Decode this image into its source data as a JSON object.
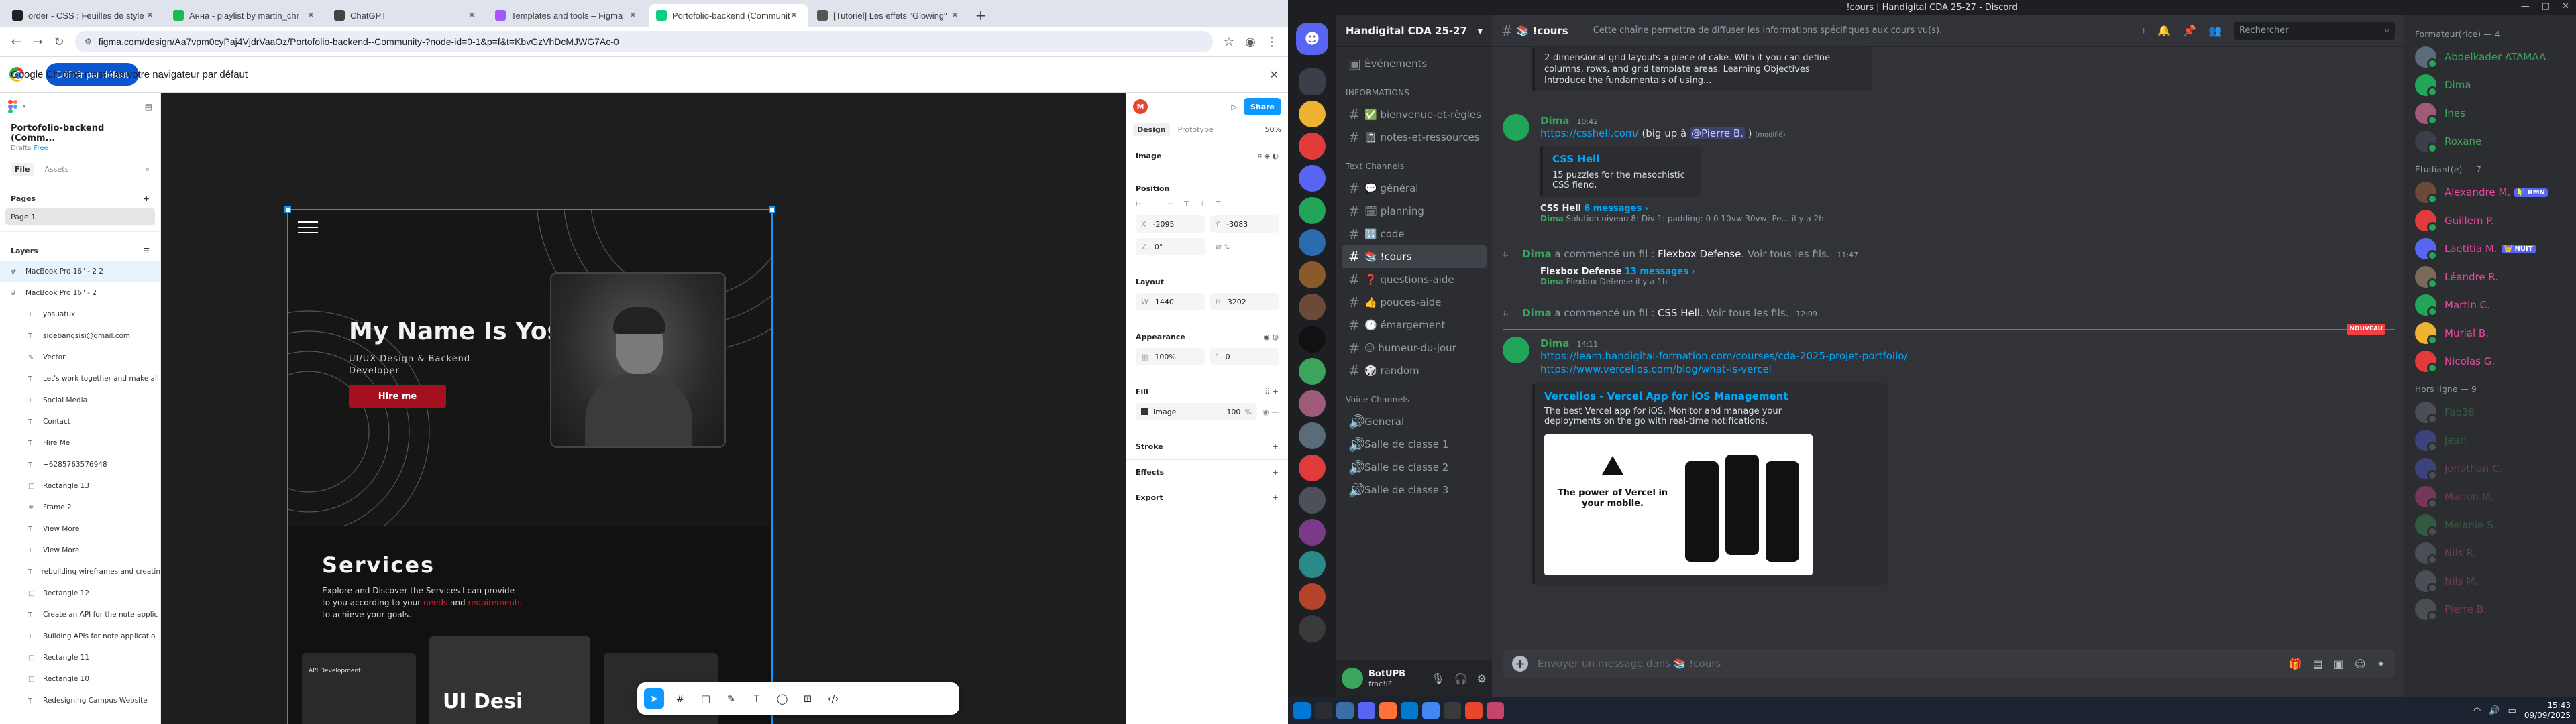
{
  "chrome": {
    "tabs": [
      {
        "title": "order - CSS : Feuilles de style",
        "color": "#202124"
      },
      {
        "title": "Анна - playlist by martin_chr",
        "color": "#1db954"
      },
      {
        "title": "ChatGPT",
        "color": "#444444"
      },
      {
        "title": "Templates and tools – Figma",
        "color": "#a259ff"
      },
      {
        "title": "Portofolio-backend (Community)",
        "color": "#0acf83"
      },
      {
        "title": "[Tutoriel] Les effets \"Glowing\"",
        "color": "#555555"
      }
    ],
    "url": "figma.com/design/Aa7vpm0cyPaj4VjdrVaaOz/Portofolio-backend--Community-?node-id=0-1&p=f&t=KbvGzVhDcMJWG7Ac-0",
    "infobar_message": "Google Chrome n'est pas votre navigateur par défaut",
    "infobar_button": "Définir par défaut"
  },
  "figma": {
    "project": "Portofolio-backend (Comm...",
    "status_left": "Drafts",
    "status_right": "Free",
    "tabs": {
      "file": "File",
      "assets": "Assets"
    },
    "pages_label": "Pages",
    "pages": [
      "Page 1"
    ],
    "layers_label": "Layers",
    "layers_top": [
      {
        "label": "MacBook Pro 16\" - 2 2",
        "selected": true
      },
      {
        "label": "MacBook Pro 16\" - 2",
        "selected": false
      }
    ],
    "layers": [
      "yosuatux",
      "sidebangsisi@gmail.com",
      "Vector",
      "Let's work together and make all",
      "Social Media",
      "Contact",
      "Hire Me",
      "+6285763576948",
      "Rectangle 13",
      "Frame 2",
      "View More",
      "View More",
      "rebuilding wireframes and creatin",
      "Rectangle 12",
      "Create an API for the note applic",
      "Building APIs for note applicatio",
      "Rectangle 11",
      "Rectangle 10",
      "Redesigning Campus Website"
    ],
    "canvas": {
      "name": "My Name Is Yosua",
      "role": "UI/UX Design & Backend Developer",
      "hire": "Hire me",
      "services_title": "Services",
      "services_text_a": "Explore and Discover the Services I can provide to you according to your",
      "services_needs": "needs",
      "services_and": "and",
      "services_req": "requirements",
      "services_text_b": "to achieve your goals.",
      "ui_title": "UI Desi",
      "api_label": "API Development"
    },
    "right": {
      "avatar": "M",
      "share": "Share",
      "tabs": {
        "design": "Design",
        "prototype": "Prototype"
      },
      "zoom": "50%",
      "image_label": "Image",
      "position_label": "Position",
      "x": "-2095",
      "y": "-3083",
      "rotation": "0°",
      "layout_label": "Layout",
      "w": "1440",
      "h": "3202",
      "appearance_label": "Appearance",
      "opacity": "100%",
      "radius": "0",
      "fill_label": "Fill",
      "fill_name": "Image",
      "fill_opacity": "100",
      "fill_pct": "%",
      "stroke_label": "Stroke",
      "effects_label": "Effects",
      "export_label": "Export"
    },
    "help": "?"
  },
  "discord": {
    "window_title": "!cours | Handigital CDA 25-27 - Discord",
    "server_name": "Handigital CDA 25-27",
    "events": "Événements",
    "info_cat": "INFORMATIONS",
    "channels_info": [
      "✅ bienvenue-et-règles",
      "📓 notes-et-ressources"
    ],
    "text_cat": "Text Channels",
    "channels_text": [
      "💬 général",
      "🗓 planning",
      "🔢 code",
      "📚 !cours",
      "❓ questions-aide",
      "👍 pouces-aide",
      "🕐 émargement",
      "😐 humeur-du-jour",
      "🎲 random"
    ],
    "selected_channel": "📚 !cours",
    "voice_cat": "Voice Channels",
    "voice": [
      "General",
      "Salle de classe 1",
      "Salle de classe 2",
      "Salle de classe 3"
    ],
    "user_name": "BotUPB",
    "user_status": "frac!IF",
    "header_channel": "📚 !cours",
    "topic": "Cette chaîne permettra de diffuser les informations spécifiques aux cours vu(s).",
    "search": "Rechercher",
    "quote_lines": [
      "2-dimensional grid layouts a piece of cake. With it you can define",
      "columns, rows, and grid template areas. Learning Objectives",
      "Introduce the fundamentals of using..."
    ],
    "msg1": {
      "author": "Dima",
      "time": "10:42",
      "link": "https://csshell.com/",
      "text": "(big up à",
      "mention": "@Pierre B.",
      "close": ")",
      "edited": "(modifié)",
      "embed_title": "CSS Hell",
      "embed_desc": "15 puzzles for the masochistic CSS fiend.",
      "thread_name": "CSS Hell",
      "thread_count": "6 messages ›",
      "thread_author": "Dima",
      "thread_preview": "Solution niveau 8: Div 1: padding: 0 0 10vw 30vw; Pe...",
      "thread_ago": "il y a 2h"
    },
    "sys1": {
      "user": "Dima",
      "text": "a commencé un fil :",
      "thread": "Flexbox Defense",
      "see": "Voir tous les fils.",
      "time": "11:47"
    },
    "thread2": {
      "name": "Flexbox Defense",
      "count": "13 messages ›",
      "author": "Dima",
      "preview": "Flexbox Defense",
      "ago": "il y a 1h"
    },
    "sys2": {
      "user": "Dima",
      "text": "a commencé un fil :",
      "thread": "CSS Hell",
      "see": "Voir tous les fils.",
      "time": "12:09"
    },
    "new_badge": "NOUVEAU",
    "msg2": {
      "author": "Dima",
      "time": "14:11",
      "link1": "https://learn.handigital-formation.com/courses/cda-2025-projet-portfolio/",
      "link2": "https://www.vercelios.com/blog/what-is-vercel",
      "embed_title": "Vercelios - Vercel App for iOS Management",
      "embed_desc": "The best Vercel app for iOS. Monitor and manage your deployments on the go with real-time notifications.",
      "img_head": "The power of Vercel in your mobile."
    },
    "composer": "Envoyer un message dans 📚 !cours",
    "members": {
      "cat1": "Formateur(rice) — 4",
      "group1": [
        {
          "name": "Abdelkader ATAMAA",
          "color": "#3ba55c",
          "av": "#5a6b7a"
        },
        {
          "name": "Dima",
          "color": "#3ba55c",
          "av": "#23a559"
        },
        {
          "name": "Ines",
          "color": "#3ba55c",
          "av": "#a05a7a"
        },
        {
          "name": "Roxane",
          "color": "#3ba55c",
          "av": "#3a3f4a"
        }
      ],
      "cat2": "Étudiant(e) — 7",
      "group2": [
        {
          "name": "Alexandre M.",
          "tag": "🔰 RMN",
          "color": "#eb459e",
          "av": "#6b4a3a"
        },
        {
          "name": "Guillem P.",
          "tag": "",
          "color": "#eb459e",
          "av": "#e23b3b"
        },
        {
          "name": "Laetitia M.",
          "tag": "👑 NUIT",
          "color": "#eb459e",
          "av": "#5865f2"
        },
        {
          "name": "Léandre R.",
          "tag": "",
          "color": "#eb459e",
          "av": "#7a6a5a"
        },
        {
          "name": "Martin C.",
          "tag": "",
          "color": "#eb459e",
          "av": "#23a559"
        },
        {
          "name": "Murial B.",
          "tag": "",
          "color": "#eb459e",
          "av": "#f0b232"
        },
        {
          "name": "Nicolas G.",
          "tag": "",
          "color": "#eb459e",
          "av": "#e23b3b"
        }
      ],
      "cat3": "Hors ligne — 9",
      "group3": [
        {
          "name": "Fab38",
          "color": "#3ba55c",
          "av": "#80848e"
        },
        {
          "name": "Jean",
          "color": "#3ba55c",
          "av": "#5865f2"
        },
        {
          "name": "Jonathan C.",
          "color": "#eb459e",
          "av": "#5865f2"
        },
        {
          "name": "Marion M.",
          "color": "#eb459e",
          "av": "#eb459e"
        },
        {
          "name": "Melanie S.",
          "color": "#3ba55c",
          "av": "#3ba55c"
        },
        {
          "name": "Nils R.",
          "color": "#eb459e",
          "av": "#80848e"
        },
        {
          "name": "Nils M.",
          "color": "#eb459e",
          "av": "#80848e"
        },
        {
          "name": "Pierre B.",
          "color": "#eb459e",
          "av": "#80848e"
        }
      ]
    }
  },
  "taskbar": {
    "time": "15:43",
    "date": "09/09/2025"
  }
}
